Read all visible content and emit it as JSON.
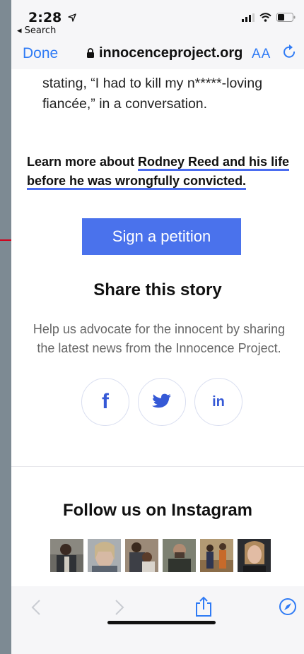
{
  "status_bar": {
    "time": "2:28",
    "back_label": "◂ Search"
  },
  "url_bar": {
    "done_label": "Done",
    "url": "innocenceproject.org",
    "text_size_label": "AA"
  },
  "article": {
    "quote_text": "stating, “I had to kill my n*****-loving fiancée,” in a conversation.",
    "learn_prefix": "Learn more about ",
    "learn_link": "Rodney Reed and his life before he was wrongfully convicted.",
    "petition_button": "Sign a petition"
  },
  "share": {
    "title": "Share this story",
    "description": "Help us advocate for the innocent by sharing the latest news from the Innocence Project.",
    "buttons": [
      {
        "icon": "facebook-icon",
        "label": "f"
      },
      {
        "icon": "twitter-icon",
        "label": ""
      },
      {
        "icon": "linkedin-icon",
        "label": "in"
      }
    ]
  },
  "instagram": {
    "title": "Follow us on Instagram",
    "thumbnails": [
      {
        "icon": "instagram-photo-man-in-jacket"
      },
      {
        "icon": "instagram-photo-woman-portrait"
      },
      {
        "icon": "instagram-photo-man-holding-child"
      },
      {
        "icon": "instagram-photo-man-bearded"
      },
      {
        "icon": "instagram-photo-group-indoors"
      },
      {
        "icon": "instagram-photo-woman-speaking"
      }
    ]
  },
  "toolbar": {
    "items": [
      "back-icon",
      "forward-icon",
      "share-icon",
      "compass-icon"
    ]
  },
  "colors": {
    "accent": "#4a72ec",
    "link_underline": "#4a6cf0",
    "safari_blue": "#2f7bf5",
    "annotation_arrow": "#d0021b",
    "gray_text": "#666666"
  }
}
